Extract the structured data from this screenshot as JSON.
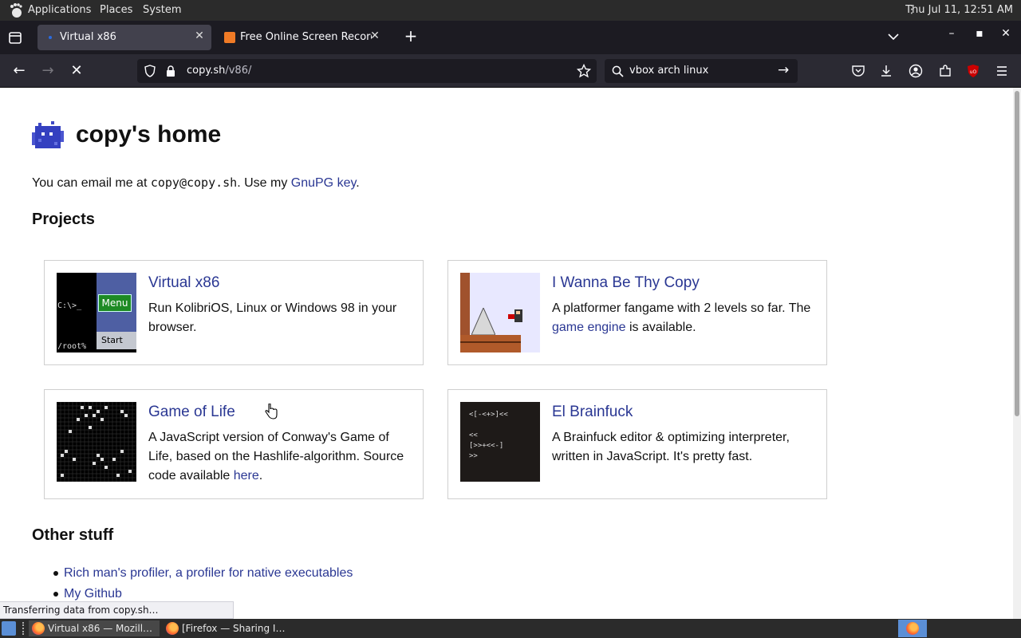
{
  "os_panel": {
    "applications": "Applications",
    "places": "Places",
    "system": "System",
    "clock": "Thu Jul 11, 12:51 AM"
  },
  "tabs": [
    {
      "title": "Virtual x86",
      "active": true
    },
    {
      "title": "Free Online Screen Recorder",
      "active": false
    }
  ],
  "navbar": {
    "url_host": "copy.sh",
    "url_path": "/v86/",
    "search_query": "vbox arch linux"
  },
  "page": {
    "site_title": "copy's home",
    "intro_prefix": "You can email me at ",
    "intro_email": "copy@copy.sh",
    "intro_middle": ". Use my ",
    "intro_link": "GnuPG key",
    "intro_suffix": ".",
    "projects_heading": "Projects",
    "projects": [
      {
        "title": "Virtual x86",
        "desc": "Run KolibriOS, Linux or Windows 98 in your browser."
      },
      {
        "title": "I Wanna Be Thy Copy",
        "desc_prefix": "A platformer fangame with 2 levels so far. The ",
        "desc_link": "game engine",
        "desc_suffix": " is available."
      },
      {
        "title": "Game of Life",
        "desc_prefix": "A JavaScript version of Conway's Game of Life, based on the Hashlife-algorithm. Source code available ",
        "desc_link": "here",
        "desc_suffix": "."
      },
      {
        "title": "El Brainfuck",
        "desc": "A Brainfuck editor & optimizing interpreter, written in JavaScript. It's pretty fast."
      }
    ],
    "thumb_v86": {
      "prompt": "C:\\>_",
      "menu": "Menu",
      "root": "/root%",
      "start": "Start"
    },
    "thumb_bf": {
      "line1": "<[-<+>]<<",
      "line2": "<<",
      "line3": "[>>+<<-]",
      "line4": ">>"
    },
    "other_heading": "Other stuff",
    "other_links": [
      "Rich man's profiler, a profiler for native executables",
      "My Github"
    ]
  },
  "status_text": "Transferring data from copy.sh…",
  "taskbar": [
    {
      "label": "Virtual x86 — Mozill…",
      "active": true
    },
    {
      "label": "[Firefox — Sharing I…",
      "active": false
    }
  ],
  "colors": {
    "link": "#2a3793",
    "chrome_dark": "#1c1b22",
    "toolbar": "#2b2a33"
  }
}
